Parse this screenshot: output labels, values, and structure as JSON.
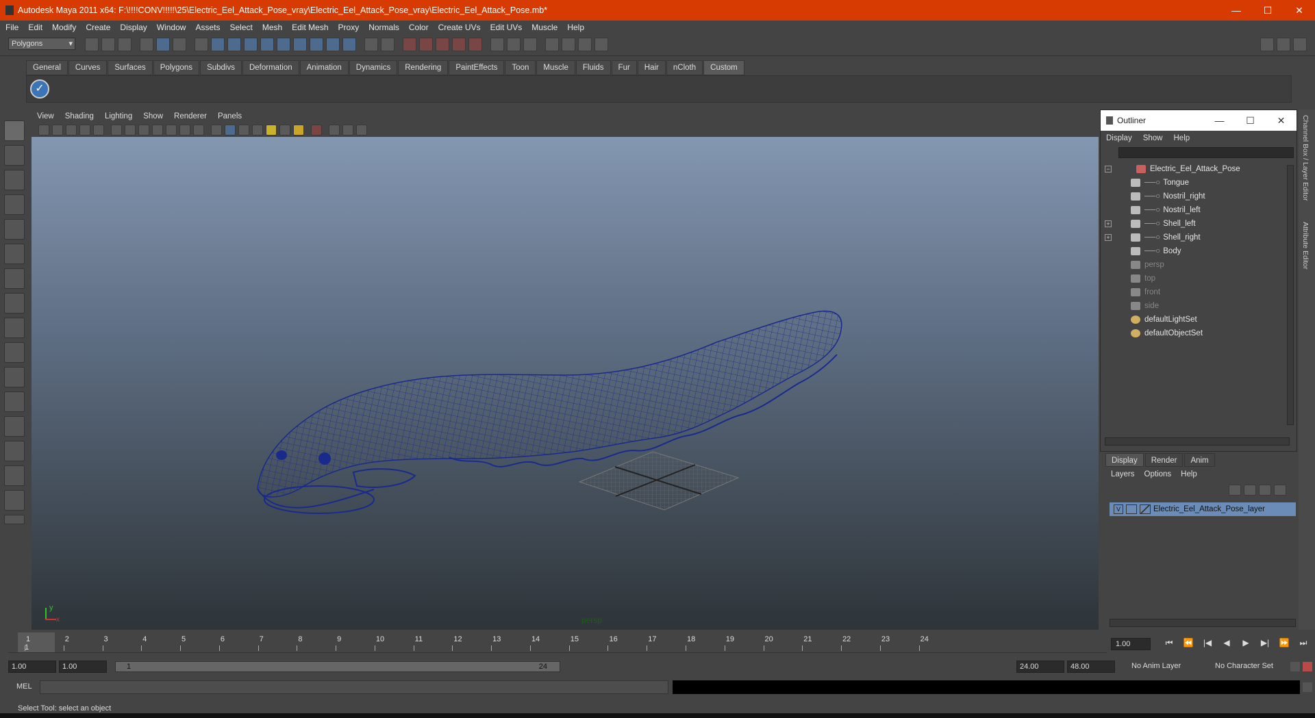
{
  "window": {
    "title": "Autodesk Maya 2011 x64: F:\\!!!!CONV!!!!!\\25\\Electric_Eel_Attack_Pose_vray\\Electric_Eel_Attack_Pose_vray\\Electric_Eel_Attack_Pose.mb*",
    "minimize": "—",
    "maximize": "☐",
    "close": "✕"
  },
  "menubar": [
    "File",
    "Edit",
    "Modify",
    "Create",
    "Display",
    "Window",
    "Assets",
    "Select",
    "Mesh",
    "Edit Mesh",
    "Proxy",
    "Normals",
    "Color",
    "Create UVs",
    "Edit UVs",
    "Muscle",
    "Help"
  ],
  "statusline": {
    "mode_select": "Polygons"
  },
  "shelf": {
    "tabs": [
      "General",
      "Curves",
      "Surfaces",
      "Polygons",
      "Subdivs",
      "Deformation",
      "Animation",
      "Dynamics",
      "Rendering",
      "PaintEffects",
      "Toon",
      "Muscle",
      "Fluids",
      "Fur",
      "Hair",
      "nCloth",
      "Custom"
    ],
    "active_tab": "Custom"
  },
  "viewport": {
    "menu": [
      "View",
      "Shading",
      "Lighting",
      "Show",
      "Renderer",
      "Panels"
    ],
    "camera_label": "persp",
    "axis": {
      "y": "y",
      "x": "x"
    }
  },
  "outliner": {
    "title": "Outliner",
    "menu": [
      "Display",
      "Show",
      "Help"
    ],
    "items": [
      {
        "label": "Electric_Eel_Attack_Pose",
        "expand": "−"
      },
      {
        "label": "Tongue"
      },
      {
        "label": "Nostril_right"
      },
      {
        "label": "Nostril_left"
      },
      {
        "label": "Shell_left",
        "expand": "+"
      },
      {
        "label": "Shell_right",
        "expand": "+"
      },
      {
        "label": "Body"
      },
      {
        "label": "persp"
      },
      {
        "label": "top"
      },
      {
        "label": "front"
      },
      {
        "label": "side"
      },
      {
        "label": "defaultLightSet"
      },
      {
        "label": "defaultObjectSet"
      }
    ]
  },
  "layers": {
    "tabs": [
      "Display",
      "Render",
      "Anim"
    ],
    "active_tab": "Display",
    "menu": [
      "Layers",
      "Options",
      "Help"
    ],
    "layer_visible": "V",
    "layer_name": "Electric_Eel_Attack_Pose_layer"
  },
  "right_strip": {
    "tab1": "Channel Box / Layer Editor",
    "tab2": "Attribute Editor"
  },
  "timeline": {
    "ticks": [
      "1",
      "2",
      "3",
      "4",
      "5",
      "6",
      "7",
      "8",
      "9",
      "10",
      "11",
      "12",
      "13",
      "14",
      "15",
      "16",
      "17",
      "18",
      "19",
      "20",
      "21",
      "22",
      "23",
      "24"
    ],
    "current_frame_marker": "1",
    "current_frame": "1.00"
  },
  "playback_controls": [
    "⏮",
    "⏪",
    "|◀",
    "◀",
    "▶",
    "▶|",
    "⏩",
    "⏭"
  ],
  "range": {
    "start": "1.00",
    "playback_start": "1.00",
    "slider_start": "1",
    "slider_end": "24",
    "playback_end": "24.00",
    "end": "48.00",
    "anim_layer": "No Anim Layer",
    "character_set": "No Character Set"
  },
  "command": {
    "label": "MEL"
  },
  "status": {
    "help_line": "Select Tool: select an object"
  },
  "colors": {
    "title_bar": "#d83b01",
    "wireframe": "#1a2a8c",
    "layer_highlight": "#6b8cb6"
  }
}
